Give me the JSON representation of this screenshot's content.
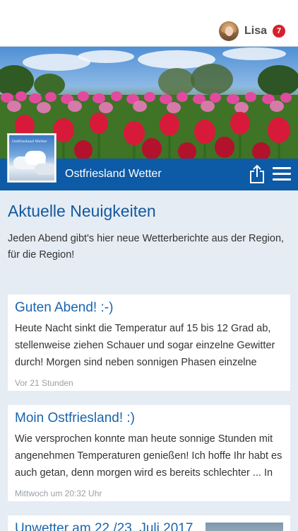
{
  "user": {
    "name": "Lisa",
    "notification_count": "7"
  },
  "banner": {
    "title": "Ostfriesland Wetter",
    "logo_text": "Ostfriesland Wetter"
  },
  "section": {
    "title": "Aktuelle Neuigkeiten",
    "intro": "Jeden Abend gibt's hier neue Wetterberichte aus der Region, für die Region!"
  },
  "posts": [
    {
      "title": "Guten Abend! :-)",
      "body": "Heute Nacht sinkt die Temperatur auf 15 bis 12 Grad ab, stellenweise ziehen Schauer und sogar einzelne Gewitter durch! Morgen sind neben sonnigen Phasen einzelne",
      "time": "Vor 21 Stunden"
    },
    {
      "title": "Moin Ostfriesland! :)",
      "body": "Wie versprochen konnte man heute sonnige Stunden mit angenehmen Temperaturen genießen! Ich hoffe Ihr habt es auch getan, denn morgen wird es bereits schlechter ... In der",
      "time": "Mittwoch um 20:32 Uhr"
    },
    {
      "title": "Unwetter am 22./23. Juli 2017",
      "body": "",
      "time": ""
    }
  ],
  "icons": {
    "share": "share-icon",
    "menu": "hamburger-menu-icon"
  },
  "colors": {
    "brand_blue": "#0d5aa6",
    "title_blue": "#12599f",
    "badge_red": "#d7202b",
    "background": "#e6ecf3"
  }
}
